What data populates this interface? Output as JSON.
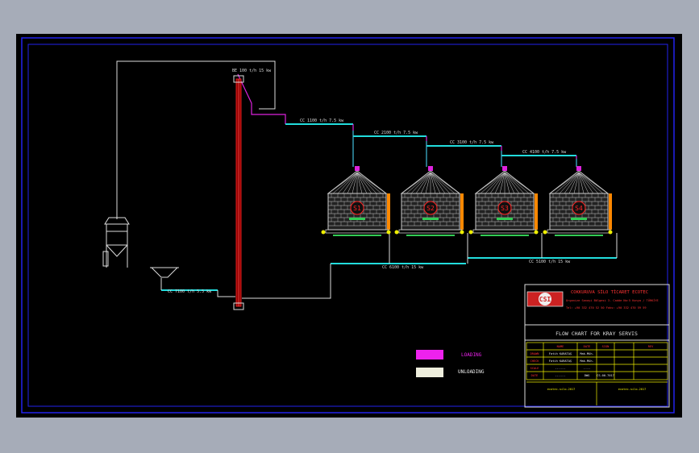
{
  "colors": {
    "frame": "#2222ee",
    "pipe_white": "#dddddd",
    "pipe_cyan": "#22dddd",
    "pipe_magenta": "#dd22dd",
    "elevator": "#dd2222",
    "silo_body": "#cccccc",
    "silo_accent": "#ff8800",
    "silo_label": "#ff2222",
    "conveyor": "#33cc55",
    "title_red": "#ff3333",
    "grid_yellow": "#eeee00"
  },
  "conveyor_labels": {
    "c1": "CC 1100 t/h  7.5 kw",
    "c2": "CC 2100 t/h  7.5 kw",
    "c3": "CC 3100 t/h  7.5 kw",
    "c4": "CC 4100 t/h  7.5 kw",
    "c5": "CC 5100 t/h  15 kw",
    "c6": "CC 6100 t/h  15 kw",
    "c7": "CC 7100 t/h  5.5 kw"
  },
  "elevator_label": "BE 100 t/h  15 kw",
  "silos": [
    {
      "label": "S1"
    },
    {
      "label": "S2"
    },
    {
      "label": "S3"
    },
    {
      "label": "S4"
    }
  ],
  "legend": {
    "loading": "LOADING",
    "unloading": "UNLOADING",
    "loading_color": "#ee22ee",
    "unloading_color": "#eeeedd"
  },
  "title_block": {
    "company": "COKKURUVA SİLO TİCARET ECOTEC",
    "address": "Organize Sanayi Bölgesi 3. Cadde No:5 Konya / TÜRKİYE",
    "phone": "Tel: +90 332 470 52 50   Faks: +90 332 470 59 59",
    "logo_text": "CSI",
    "drawing_title": "FLOW CHART FOR KRAY SERVIS",
    "grid_head": [
      "",
      "NAME",
      "DATE",
      "SIGN",
      "",
      "REV"
    ],
    "grid_rows": [
      [
        "DRAWN",
        "Fatih KARATAŞ",
        "Mak.Müh.",
        "",
        ""
      ],
      [
        "CHECK",
        "Fatih KARATAŞ",
        "Mak.Müh.",
        "",
        ""
      ],
      [
        "SCALE",
        "------",
        "----",
        "",
        ""
      ],
      [
        "DATE",
        "------",
        "DWG",
        "CS-00-7017",
        ""
      ]
    ],
    "footer": [
      "ecotec-silo-2017",
      "ecotec-silo-2017"
    ]
  }
}
